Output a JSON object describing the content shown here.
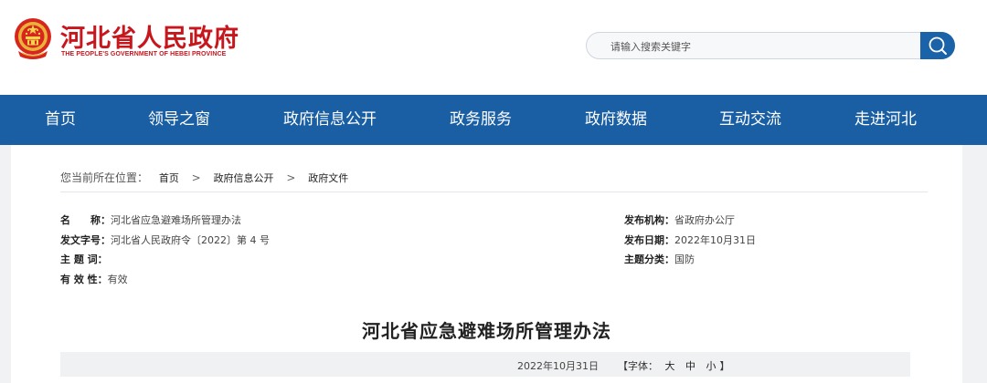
{
  "header": {
    "title": "河北省人民政府",
    "subtitle": "THE PEOPLE'S GOVERNMENT OF HEBEI PROVINCE",
    "brand_color": "#c8161d"
  },
  "search": {
    "placeholder": "请输入搜索关键字",
    "button_icon": "search-icon"
  },
  "nav": {
    "items": [
      "首页",
      "领导之窗",
      "政府信息公开",
      "政务服务",
      "政府数据",
      "互动交流",
      "走进河北"
    ],
    "background": "#1a5fa4"
  },
  "breadcrumb": {
    "prefix": "您当前所在位置：",
    "items": [
      "首页",
      "政府信息公开",
      "政府文件"
    ]
  },
  "meta": {
    "name_label": "名　　称：",
    "name_value": "河北省应急避难场所管理办法",
    "doc_no_label": "发文字号：",
    "doc_no_value": "河北省人民政府令〔2022〕第 4 号",
    "keywords_label": "主 题 词：",
    "keywords_value": "",
    "validity_label": "有 效 性：",
    "validity_value": "有效",
    "issuer_label": "发布机构：",
    "issuer_value": "省政府办公厅",
    "date_label": "发布日期：",
    "date_value": "2022年10月31日",
    "category_label": "主题分类：",
    "category_value": "国防"
  },
  "document": {
    "title": "河北省应急避难场所管理办法",
    "date": "2022年10月31日",
    "font_prefix": "【字体：",
    "font_large": "大",
    "font_medium": "中",
    "font_small": "小",
    "font_suffix": "】"
  }
}
